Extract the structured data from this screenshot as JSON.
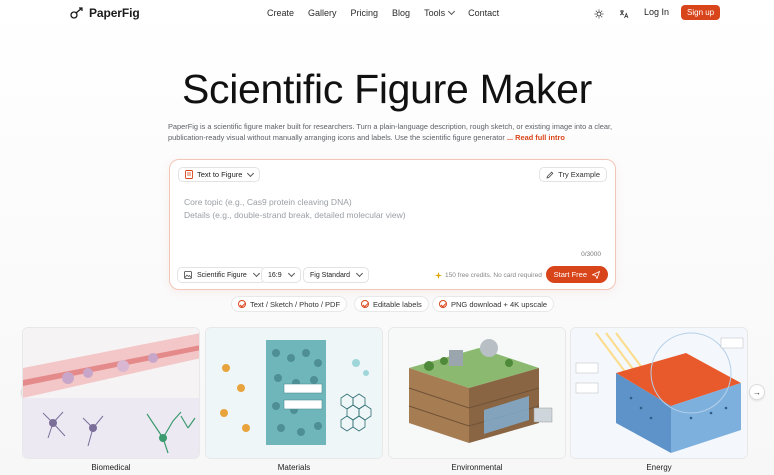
{
  "brand": {
    "name": "PaperFig",
    "accent": "#d9451a"
  },
  "nav": {
    "items": [
      "Create",
      "Gallery",
      "Pricing",
      "Blog",
      "Tools",
      "Contact"
    ],
    "login": "Log In",
    "signup": "Sign up"
  },
  "hero": {
    "title": "Scientific Figure Maker",
    "description": "PaperFig is a scientific figure maker built for researchers. Turn a plain-language description, rough sketch, or existing image into a clear, publication-ready visual without manually arranging icons and labels. Use the scientific figure generator",
    "read_more": "... Read full intro"
  },
  "composer": {
    "mode": "Text to Figure",
    "try_example": "Try Example",
    "placeholder_line1": "Core topic (e.g., Cas9 protein cleaving DNA)",
    "placeholder_line2": "Details (e.g., double-strand break, detailed molecular view)",
    "counter": "0/3000",
    "style": "Scientific Figure",
    "ratio": "16:9",
    "quality": "Fig Standard",
    "credits": "150 free credits. No card required",
    "start": "Start Free"
  },
  "features": [
    "Text / Sketch / Photo / PDF",
    "Editable labels",
    "PNG download + 4K upscale"
  ],
  "gallery": {
    "items": [
      {
        "label": "Biomedical"
      },
      {
        "label": "Materials"
      },
      {
        "label": "Environmental"
      },
      {
        "label": "Energy"
      }
    ]
  }
}
